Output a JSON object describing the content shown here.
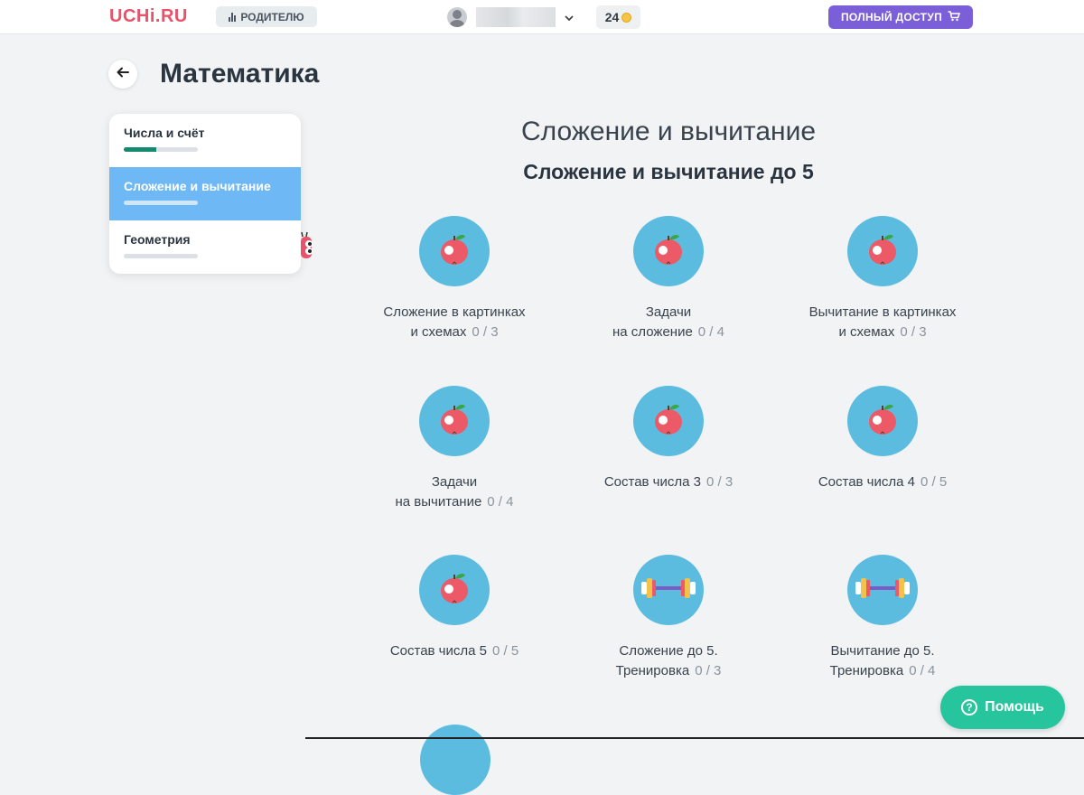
{
  "header": {
    "logo": "UCHi.RU",
    "parent_label": "РОДИТЕЛЮ",
    "coins": "24",
    "full_access_label": "ПОЛНЫЙ ДОСТУП",
    "icons": {
      "parent": "bar-chart-icon",
      "cart": "cart-icon",
      "coin": "coin-icon",
      "chevron": "chevron-down-icon"
    }
  },
  "page": {
    "title": "Математика"
  },
  "sidebar": {
    "items": [
      {
        "label": "Числа и счёт",
        "progress": 0.44,
        "active": false
      },
      {
        "label": "Сложение и вычитание",
        "progress": 0,
        "active": true
      },
      {
        "label": "Геометрия",
        "progress": 0,
        "active": false
      }
    ]
  },
  "section": {
    "title": "Сложение и вычитание",
    "subtitle": "Сложение и вычитание до 5"
  },
  "topics": [
    {
      "line1": "Сложение в картинках",
      "line2": "и схемах",
      "score": "0 / 3",
      "icon": "apple"
    },
    {
      "line1": "Задачи",
      "line2": "на сложение",
      "score": "0 / 4",
      "icon": "apple"
    },
    {
      "line1": "Вычитание в картинках",
      "line2": "и схемах",
      "score": "0 / 3",
      "icon": "apple"
    },
    {
      "line1": "Задачи",
      "line2": "на вычитание",
      "score": "0 / 4",
      "icon": "apple"
    },
    {
      "line1": "",
      "line2": "Состав числа 3",
      "score": "0 / 3",
      "icon": "apple"
    },
    {
      "line1": "",
      "line2": "Состав числа 4",
      "score": "0 / 5",
      "icon": "apple"
    },
    {
      "line1": "",
      "line2": "Состав числа 5",
      "score": "0 / 5",
      "icon": "apple"
    },
    {
      "line1": "Сложение до 5.",
      "line2": "Тренировка",
      "score": "0 / 3",
      "icon": "dumbbell"
    },
    {
      "line1": "Вычитание до 5.",
      "line2": "Тренировка",
      "score": "0 / 4",
      "icon": "dumbbell"
    }
  ],
  "help": {
    "label": "Помощь"
  },
  "colors": {
    "accent_purple": "#7a5fd8",
    "active_tab": "#6db8f5",
    "help_green": "#27c59d",
    "topic_circle": "#5bbce0",
    "progress_green": "#168a6e",
    "logo_red": "#e8526a"
  }
}
